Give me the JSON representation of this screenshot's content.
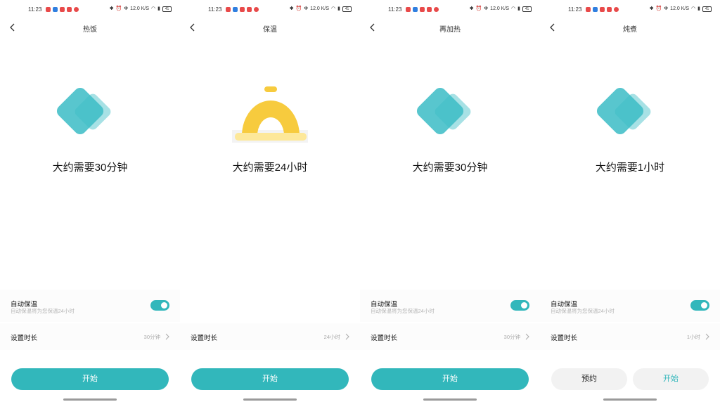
{
  "status_bar": {
    "time": "11:23",
    "network_speed": "12.0 K/S",
    "battery": "41"
  },
  "colors": {
    "accent": "#32b7bb",
    "diamond_dark": "#3bbcc6",
    "diamond_light": "#a8e2e8",
    "bell_yellow": "#f7cb3e",
    "bell_base": "#fde89a"
  },
  "screens": [
    {
      "title": "热饭",
      "icon": "diamond-icon",
      "estimate": "大约需要30分钟",
      "auto_warm_label": "自动保温",
      "auto_warm_sub": "自动保温将为您保温24小时",
      "auto_warm_on": true,
      "duration_label": "设置时长",
      "duration_value": "30分钟",
      "start_label": "开始"
    },
    {
      "title": "保温",
      "icon": "bell-icon",
      "estimate": "大约需要24小时",
      "duration_label": "设置时长",
      "duration_value": "24小时",
      "start_label": "开始"
    },
    {
      "title": "再加热",
      "icon": "diamond-icon",
      "estimate": "大约需要30分钟",
      "auto_warm_label": "自动保温",
      "auto_warm_sub": "自动保温将为您保温24小时",
      "auto_warm_on": true,
      "duration_label": "设置时长",
      "duration_value": "30分钟",
      "start_label": "开始"
    },
    {
      "title": "炖煮",
      "icon": "diamond-icon",
      "estimate": "大约需要1小时",
      "auto_warm_label": "自动保温",
      "auto_warm_sub": "自动保温将为您保温24小时",
      "auto_warm_on": true,
      "duration_label": "设置时长",
      "duration_value": "1小时",
      "reserve_label": "预约",
      "start_label": "开始"
    }
  ]
}
